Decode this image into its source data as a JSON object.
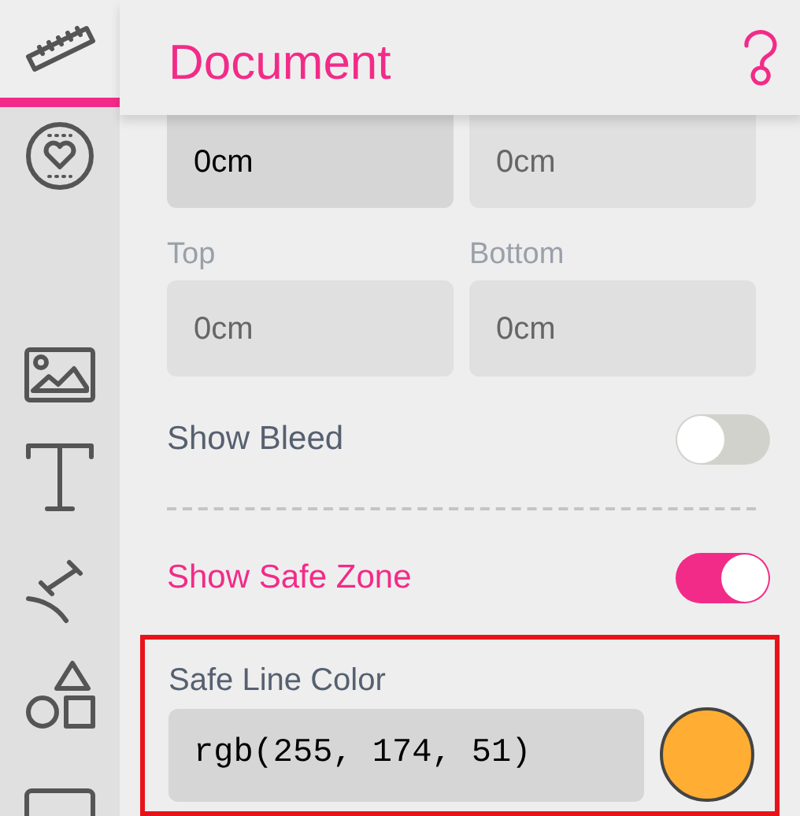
{
  "sidebar": {
    "items": [
      {
        "kind": "ruler",
        "selected": true
      },
      {
        "kind": "badge",
        "selected": false
      },
      {
        "kind": "image",
        "selected": false
      },
      {
        "kind": "text",
        "selected": false
      },
      {
        "kind": "tool",
        "selected": false
      },
      {
        "kind": "shapes",
        "selected": false
      },
      {
        "kind": "frame",
        "selected": false
      }
    ]
  },
  "header": {
    "title": "Document"
  },
  "margin_fields": [
    {
      "value": "0cm",
      "focused": true
    },
    {
      "value": "0cm",
      "focused": false
    }
  ],
  "bleed_fields": [
    {
      "label": "Top",
      "value": "0cm"
    },
    {
      "label": "Bottom",
      "value": "0cm"
    }
  ],
  "toggles": [
    {
      "label": "Show Bleed",
      "on": false
    },
    {
      "label": "Show Safe Zone",
      "on": true
    }
  ],
  "safe_line": {
    "label": "Safe Line Color",
    "value": "rgb(255, 174, 51)",
    "color": "#ffae33",
    "highlighted": true
  }
}
